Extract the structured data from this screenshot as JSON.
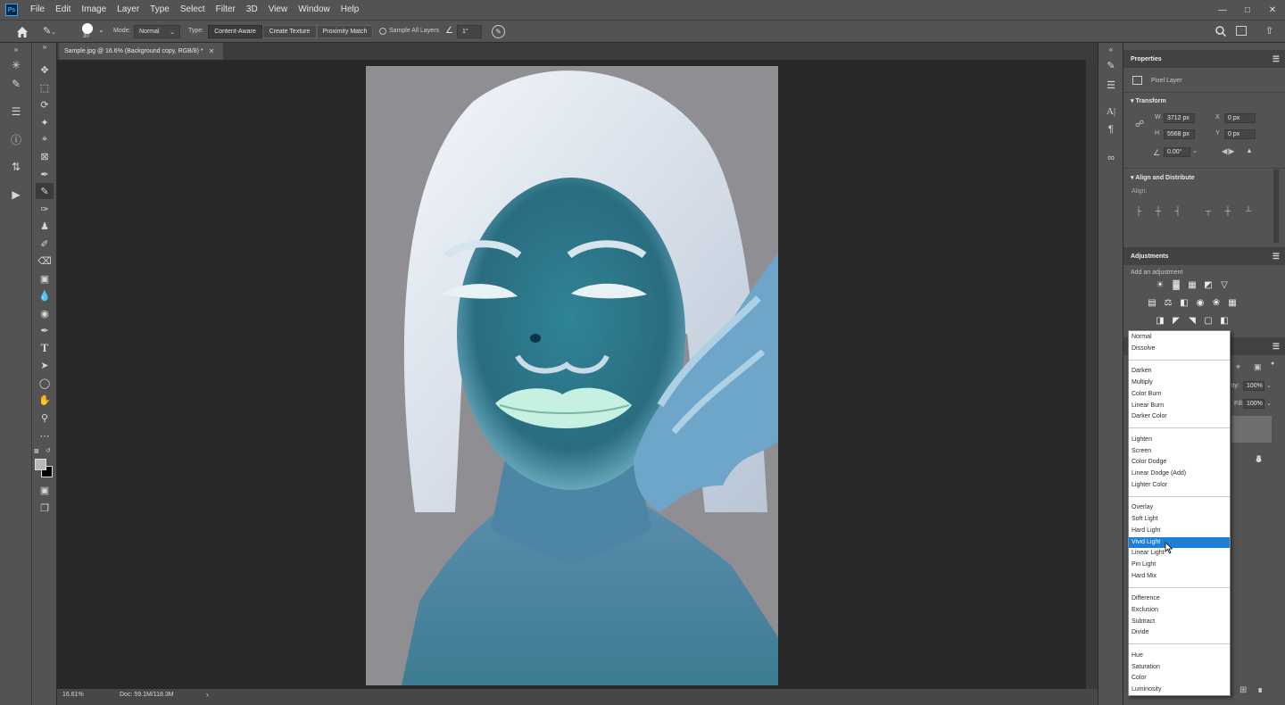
{
  "app": {
    "logo_text": "Ps"
  },
  "menu": [
    "File",
    "Edit",
    "Image",
    "Layer",
    "Type",
    "Select",
    "Filter",
    "3D",
    "View",
    "Window",
    "Help"
  ],
  "options_bar": {
    "brush_size": "30",
    "mode_label": "Mode:",
    "mode_value": "Normal",
    "type_label": "Type:",
    "type_buttons": [
      "Content-Aware",
      "Create Texture",
      "Proximity Match"
    ],
    "type_selected": "Content-Aware",
    "sample_all_layers": "Sample All Layers",
    "angle_value": "1°"
  },
  "document": {
    "tab_title": "Sample.jpg @ 16.6% (Background copy, RGB/8) *",
    "zoom": "16.61%",
    "doc_size": "Doc: 59.1M/118.3M"
  },
  "properties": {
    "title": "Properties",
    "layer_type": "Pixel Layer",
    "transform_title": "Transform",
    "w_label": "W",
    "w_value": "3712 px",
    "h_label": "H",
    "h_value": "5568 px",
    "x_label": "X",
    "x_value": "0 px",
    "y_label": "Y",
    "y_value": "0 px",
    "angle_value": "0.00°",
    "align_title": "Align and Distribute",
    "align_label": "Align:"
  },
  "adjustments": {
    "title": "Adjustments",
    "subtitle": "Add an adjustment"
  },
  "layers_partial": {
    "opacity_label": "ity:",
    "opacity_value": "100%",
    "fill_label": "Fill:",
    "fill_value": "100%"
  },
  "blend_modes": {
    "selected": "Vivid Light",
    "groups": [
      [
        "Normal",
        "Dissolve"
      ],
      [
        "Darken",
        "Multiply",
        "Color Burn",
        "Linear Burn",
        "Darker Color"
      ],
      [
        "Lighten",
        "Screen",
        "Color Dodge",
        "Linear Dodge (Add)",
        "Lighter Color"
      ],
      [
        "Overlay",
        "Soft Light",
        "Hard Light",
        "Vivid Light",
        "Linear Light",
        "Pin Light",
        "Hard Mix"
      ],
      [
        "Difference",
        "Exclusion",
        "Subtract",
        "Divide"
      ],
      [
        "Hue",
        "Saturation",
        "Color",
        "Luminosity"
      ]
    ]
  },
  "colors": {
    "accent_selected": "#1d7fd6",
    "panel_bg": "#535353",
    "canvas_bg": "#282828",
    "photo_bg": "#8f8f93"
  }
}
